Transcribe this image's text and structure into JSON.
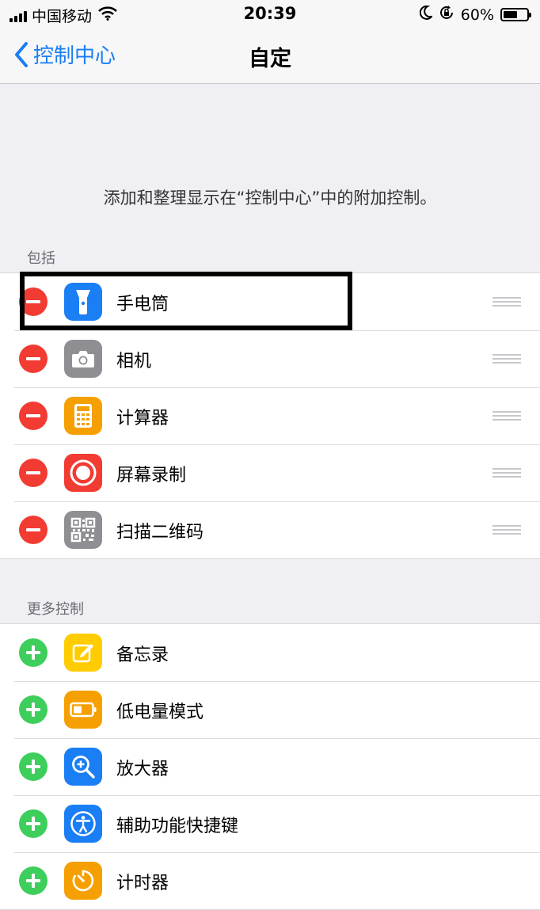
{
  "status_bar": {
    "carrier": "中国移动",
    "time": "20:39",
    "battery_percent": "60%",
    "battery_level": 0.6,
    "icons": [
      "signal-icon",
      "wifi-icon",
      "moon-icon",
      "orientation-lock-icon",
      "battery-icon"
    ]
  },
  "nav": {
    "back_label": "控制中心",
    "title": "自定"
  },
  "description": "添加和整理显示在“控制中心”中的附加控制。",
  "included": {
    "header": "包括",
    "items": [
      {
        "label": "手电筒",
        "icon": "flashlight-icon",
        "color": "#1a7ef5"
      },
      {
        "label": "相机",
        "icon": "camera-icon",
        "color": "#8e8e93"
      },
      {
        "label": "计算器",
        "icon": "calculator-icon",
        "color": "#f5a000"
      },
      {
        "label": "屏幕录制",
        "icon": "screen-record-icon",
        "color": "#f23b32"
      },
      {
        "label": "扫描二维码",
        "icon": "qr-code-icon",
        "color": "#8e8e93"
      }
    ]
  },
  "more": {
    "header": "更多控制",
    "items": [
      {
        "label": "备忘录",
        "icon": "notes-icon",
        "color": "#ffcc00"
      },
      {
        "label": "低电量模式",
        "icon": "low-power-icon",
        "color": "#f5a000"
      },
      {
        "label": "放大器",
        "icon": "magnifier-icon",
        "color": "#1a7ef5"
      },
      {
        "label": "辅助功能快捷键",
        "icon": "accessibility-icon",
        "color": "#1a7ef5"
      },
      {
        "label": "计时器",
        "icon": "timer-icon",
        "color": "#f5a000"
      }
    ]
  },
  "colors": {
    "accent": "#1a7ef5",
    "remove": "#f23b32",
    "add": "#3dce5b",
    "background": "#efeff4"
  }
}
